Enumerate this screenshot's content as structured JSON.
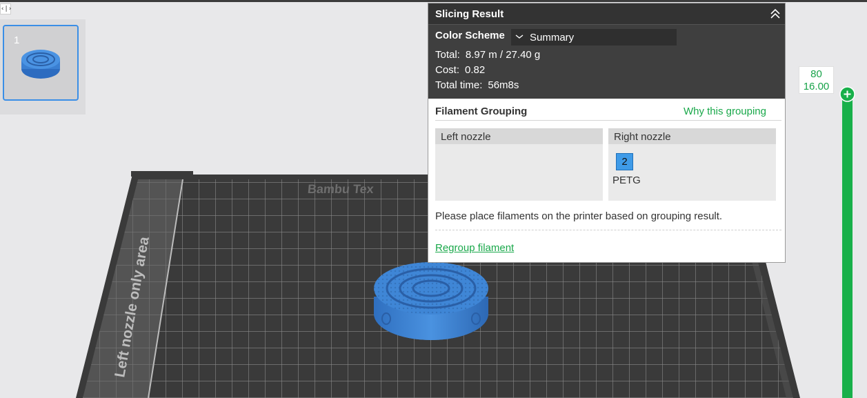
{
  "plate": {
    "number": "1"
  },
  "bed": {
    "brand_text": "Bambu Tex",
    "left_zone_text": "Left nozzle only area"
  },
  "slicing_result": {
    "title": "Slicing Result",
    "color_scheme_label": "Color Scheme",
    "color_scheme_value": "Summary",
    "stats": [
      {
        "label": "Total:",
        "value": "8.97 m / 27.40 g"
      },
      {
        "label": "Cost:",
        "value": "0.82"
      },
      {
        "label": "Total time:",
        "value": "56m8s"
      }
    ]
  },
  "filament_grouping": {
    "title": "Filament Grouping",
    "why_link": "Why this grouping",
    "left_nozzle_label": "Left nozzle",
    "right_nozzle_label": "Right nozzle",
    "right_filament": {
      "slot": "2",
      "type": "PETG",
      "color": "#3f9be8"
    },
    "note": "Please place filaments on the printer based on grouping result.",
    "regroup_link": "Regroup filament"
  },
  "layer_slider": {
    "layer": "80",
    "height": "16.00"
  },
  "colors": {
    "accent_green": "#19a84a",
    "model_blue": "#3f86d6",
    "bed_dark": "#3a3a3a"
  }
}
